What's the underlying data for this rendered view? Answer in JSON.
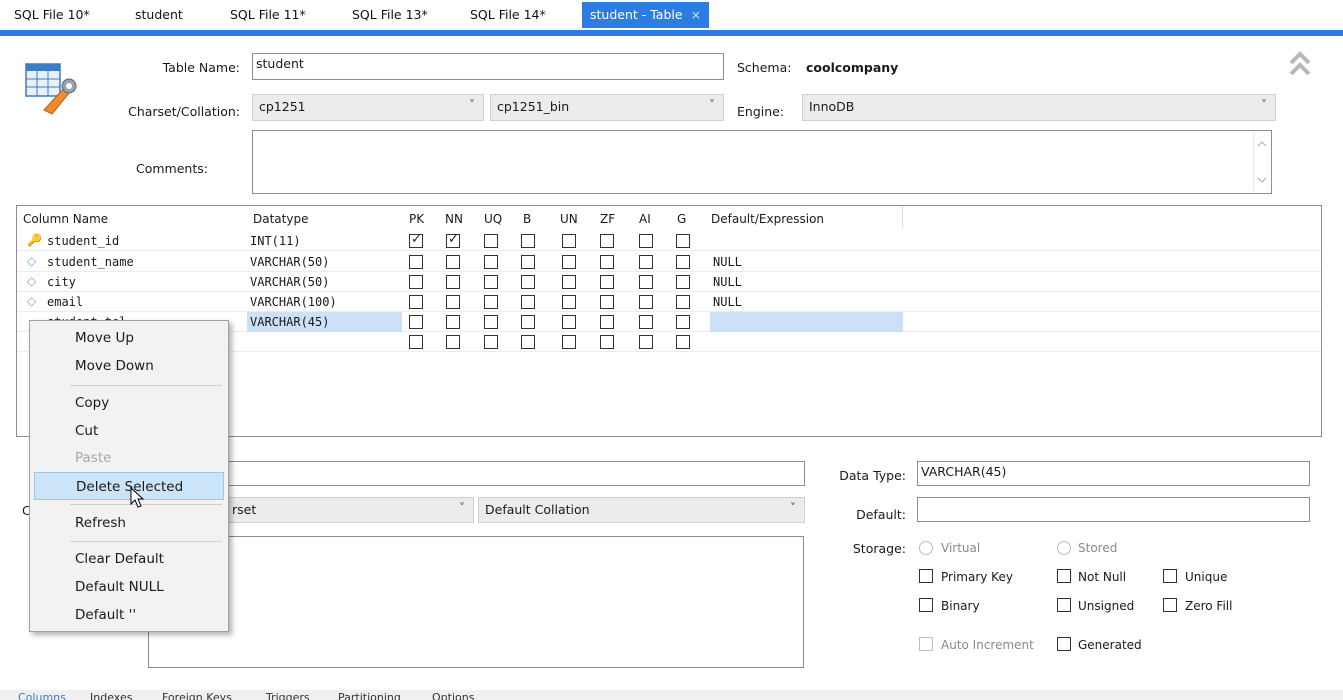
{
  "tabs": [
    {
      "label": "SQL File 10*"
    },
    {
      "label": "student"
    },
    {
      "label": "SQL File 11*"
    },
    {
      "label": "SQL File 13*"
    },
    {
      "label": "SQL File 14*"
    },
    {
      "label": "student - Table",
      "close": "×"
    }
  ],
  "table_form": {
    "table_name_label": "Table Name:",
    "table_name_value": "student",
    "schema_label": "Schema:",
    "schema_value": "coolcompany",
    "charset_label": "Charset/Collation:",
    "charset_value": "cp1251",
    "collation_value": "cp1251_bin",
    "engine_label": "Engine:",
    "engine_value": "InnoDB",
    "comments_label": "Comments:",
    "chevron": "˅"
  },
  "grid": {
    "headers": [
      "Column Name",
      "Datatype",
      "PK",
      "NN",
      "UQ",
      "B",
      "UN",
      "ZF",
      "AI",
      "G",
      "Default/Expression"
    ],
    "rows": [
      {
        "name": "student_id",
        "type": "INT(11)",
        "default": "",
        "pk": true,
        "nn": true
      },
      {
        "name": "student_name",
        "type": "VARCHAR(50)",
        "default": "NULL",
        "pk": false,
        "nn": false
      },
      {
        "name": "city",
        "type": "VARCHAR(50)",
        "default": "NULL",
        "pk": false,
        "nn": false
      },
      {
        "name": "email",
        "type": "VARCHAR(100)",
        "default": "NULL",
        "pk": false,
        "nn": false
      },
      {
        "name": "student_tel",
        "type": "VARCHAR(45)",
        "default": "",
        "pk": false,
        "nn": false
      }
    ]
  },
  "context_menu": {
    "items": [
      "Move Up",
      "Move Down",
      "Copy",
      "Cut",
      "Paste",
      "Delete Selected",
      "Refresh",
      "Clear Default",
      "Default NULL",
      "Default ''"
    ]
  },
  "details": {
    "charset_partial": "rset",
    "collation_value": "Default Collation",
    "data_type_label": "Data Type:",
    "data_type_value": "VARCHAR(45)",
    "default_label": "Default:",
    "storage_label": "Storage:",
    "virtual_label": "Virtual",
    "stored_label": "Stored",
    "primary_key_label": "Primary Key",
    "not_null_label": "Not Null",
    "unique_label": "Unique",
    "binary_label": "Binary",
    "unsigned_label": "Unsigned",
    "zero_fill_label": "Zero Fill",
    "auto_increment_label": "Auto Increment",
    "generated_label": "Generated",
    "detail_c_partial": "C"
  },
  "bottom_tabs": [
    "Columns",
    "Indexes",
    "Foreign Keys",
    "Triggers",
    "Partitioning",
    "Options"
  ]
}
